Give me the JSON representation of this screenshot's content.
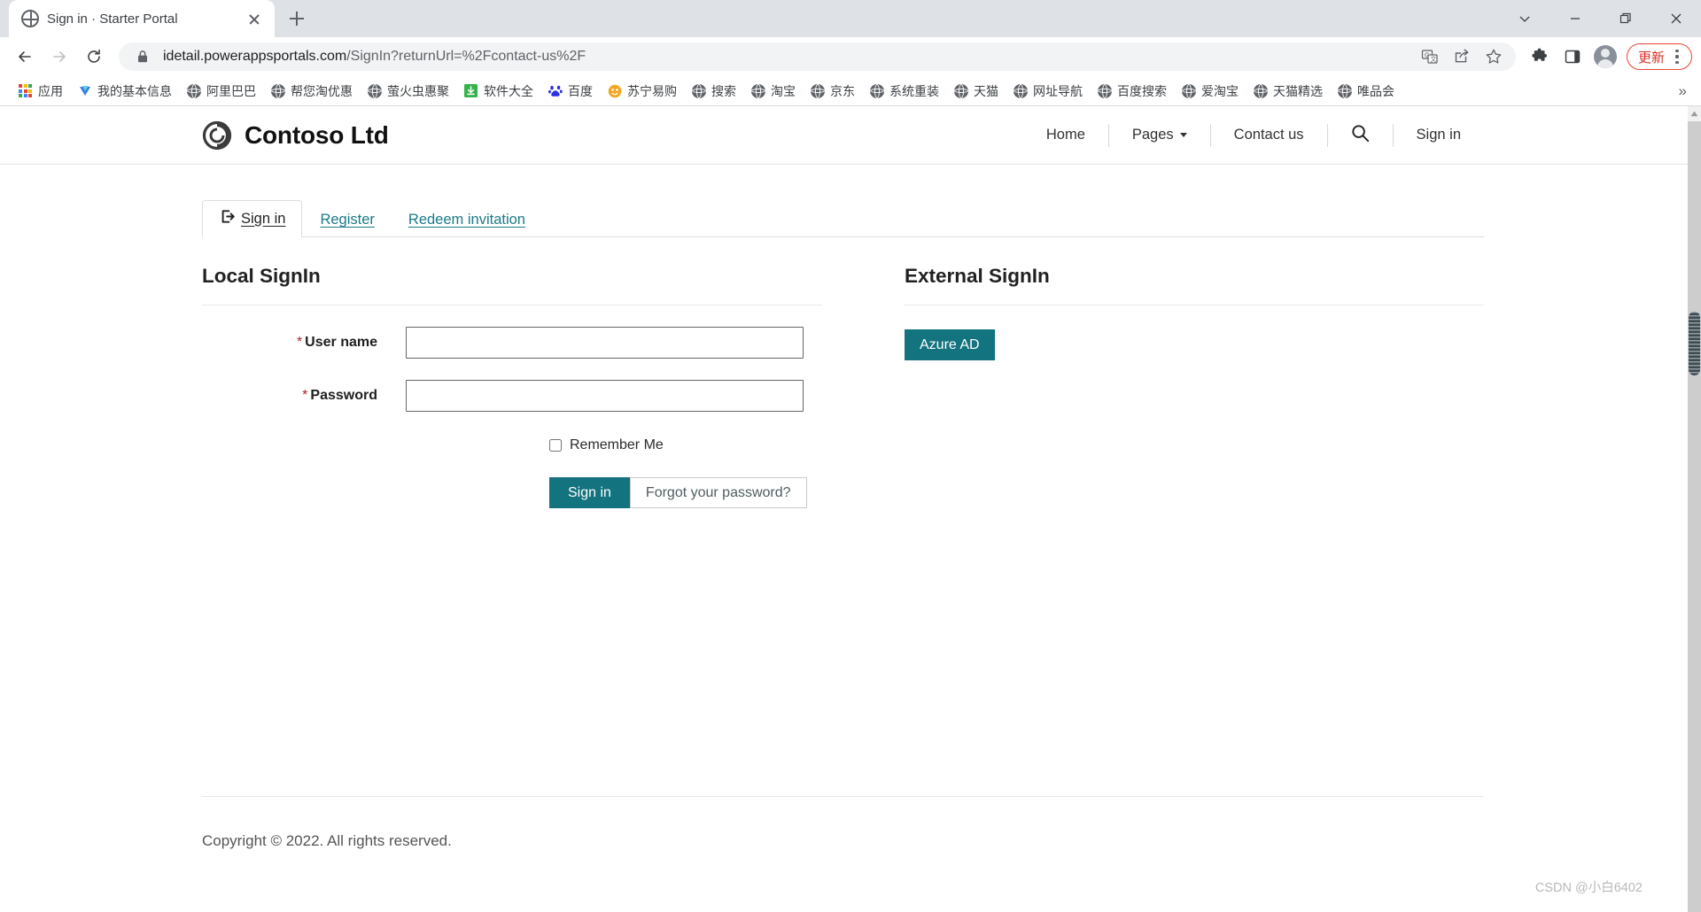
{
  "browser": {
    "tab": {
      "title": "Sign in · Starter Portal",
      "favicon": "globe-icon",
      "close": "×"
    },
    "newtab_label": "+",
    "window_controls": {
      "tab_search": "tab-search-icon",
      "minimize": "minimize-icon",
      "maximize": "maximize-icon",
      "close": "close-icon"
    },
    "nav": {
      "back": "back-icon",
      "forward": "forward-icon",
      "reload": "reload-icon"
    },
    "omnibox": {
      "lock": "lock-icon",
      "url_bold": "idetail.powerappsportals.com",
      "url_dim": "/SignIn?returnUrl=%2Fcontact-us%2F",
      "translate": "translate-icon",
      "share": "share-icon",
      "bookmark": "star-icon"
    },
    "toolbar": {
      "extensions": "puzzle-icon",
      "side_panel": "side-panel-icon",
      "profile": "avatar-icon",
      "update_label": "更新",
      "menu": "kebab-menu-icon"
    },
    "bookmarks": [
      {
        "label": "应用",
        "icon": "apps-grid-icon"
      },
      {
        "label": "我的基本信息",
        "icon": "blue-favicon"
      },
      {
        "label": "阿里巴巴",
        "icon": "globe-icon"
      },
      {
        "label": "帮您淘优惠",
        "icon": "globe-icon"
      },
      {
        "label": "萤火虫惠聚",
        "icon": "globe-icon"
      },
      {
        "label": "软件大全",
        "icon": "green-download-icon"
      },
      {
        "label": "百度",
        "icon": "baidu-icon"
      },
      {
        "label": "苏宁易购",
        "icon": "orange-favicon"
      },
      {
        "label": "搜索",
        "icon": "globe-icon"
      },
      {
        "label": "淘宝",
        "icon": "globe-icon"
      },
      {
        "label": "京东",
        "icon": "globe-icon"
      },
      {
        "label": "系统重装",
        "icon": "globe-icon"
      },
      {
        "label": "天猫",
        "icon": "globe-icon"
      },
      {
        "label": "网址导航",
        "icon": "globe-icon"
      },
      {
        "label": "百度搜索",
        "icon": "globe-icon"
      },
      {
        "label": "爱淘宝",
        "icon": "globe-icon"
      },
      {
        "label": "天猫精选",
        "icon": "globe-icon"
      },
      {
        "label": "唯品会",
        "icon": "globe-icon"
      }
    ],
    "bookmarks_overflow": "»"
  },
  "site": {
    "brand": {
      "name": "Contoso Ltd",
      "logo": "contoso-swirl-logo"
    },
    "nav": [
      {
        "label": "Home",
        "type": "link"
      },
      {
        "label": "Pages",
        "type": "dropdown"
      },
      {
        "label": "Contact us",
        "type": "link"
      },
      {
        "label": "",
        "type": "search",
        "icon": "search-icon"
      },
      {
        "label": "Sign in",
        "type": "link"
      }
    ]
  },
  "page": {
    "tabs": [
      {
        "label": "Sign in",
        "active": true,
        "icon": "sign-in-icon"
      },
      {
        "label": "Register",
        "active": false
      },
      {
        "label": "Redeem invitation",
        "active": false
      }
    ],
    "local": {
      "title": "Local SignIn",
      "username_label": "User name",
      "password_label": "Password",
      "required_mark": "*",
      "username_value": "",
      "password_value": "",
      "remember_label": "Remember Me",
      "remember_checked": false,
      "signin_button": "Sign in",
      "forgot_button": "Forgot your password?"
    },
    "external": {
      "title": "External SignIn",
      "azure_button": "Azure AD"
    },
    "footer": {
      "copyright": "Copyright © 2022. All rights reserved."
    }
  },
  "watermark": {
    "text": "CSDN @小白6402"
  },
  "colors": {
    "accent": "#13737f",
    "link": "#1b7b86",
    "required": "#a4262c",
    "update": "#d93025"
  }
}
